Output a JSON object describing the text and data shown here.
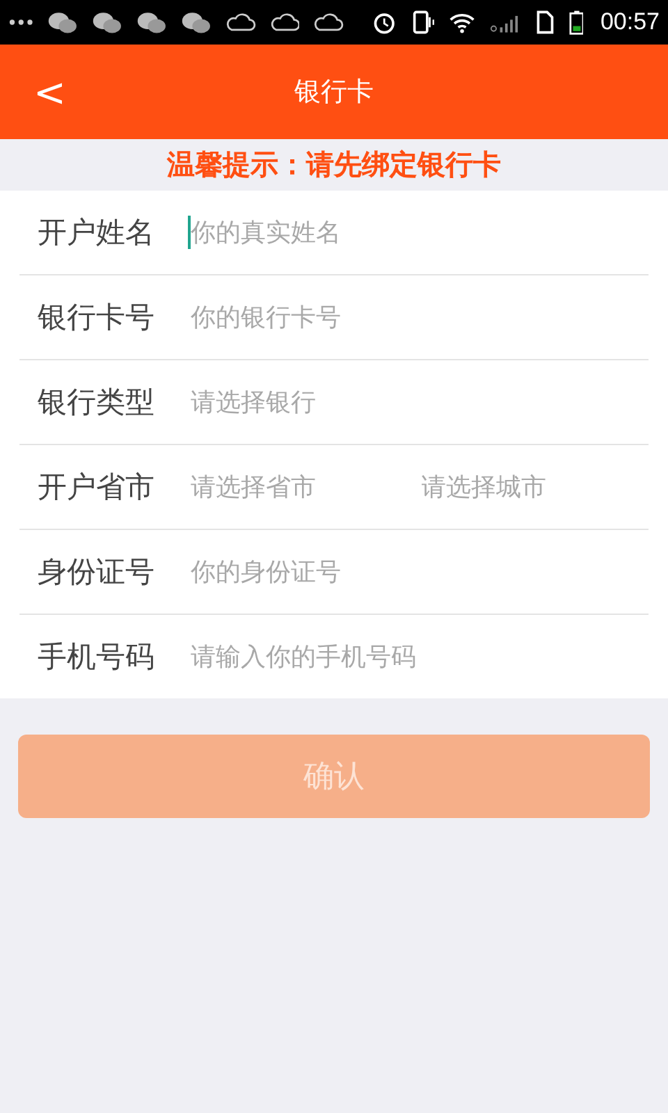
{
  "status_bar": {
    "time": "00:57"
  },
  "header": {
    "back": "<",
    "title": "银行卡"
  },
  "notice": "温馨提示：请先绑定银行卡",
  "form": [
    {
      "label": "开户姓名",
      "fields": [
        {
          "placeholder": "你的真实姓名",
          "focused": true
        }
      ]
    },
    {
      "label": "银行卡号",
      "fields": [
        {
          "placeholder": "你的银行卡号",
          "focused": false
        }
      ]
    },
    {
      "label": "银行类型",
      "fields": [
        {
          "placeholder": "请选择银行",
          "focused": false
        }
      ]
    },
    {
      "label": "开户省市",
      "fields": [
        {
          "placeholder": "请选择省市",
          "focused": false
        },
        {
          "placeholder": "请选择城市",
          "focused": false
        }
      ]
    },
    {
      "label": "身份证号",
      "fields": [
        {
          "placeholder": "你的身份证号",
          "focused": false
        }
      ]
    },
    {
      "label": "手机号码",
      "fields": [
        {
          "placeholder": "请输入你的手机号码",
          "focused": false
        }
      ]
    }
  ],
  "confirm": {
    "label": "确认",
    "disabled": true
  }
}
